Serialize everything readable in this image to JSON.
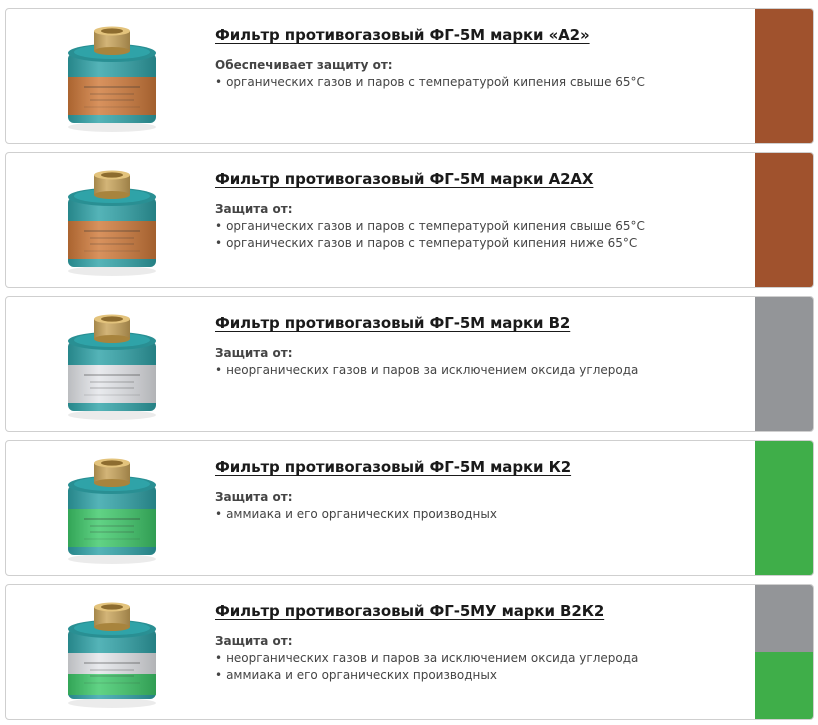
{
  "products": [
    {
      "title": "Фильтр противогазовый ФГ-5М марки «А2»",
      "subtitle": "Обеспечивает защиту от:",
      "items": [
        "органических газов и паров с температурой кипения свыше 65°С"
      ],
      "colors": [
        "#a0522d"
      ],
      "image": {
        "body": "#2fa3a8",
        "band": "#d07a3a",
        "label": "ФГ-5М  А2"
      }
    },
    {
      "title": "Фильтр противогазовый ФГ-5М марки А2АХ",
      "subtitle": "Защита от:",
      "items": [
        "органических газов и паров с температурой кипения свыше 65°С",
        "органических газов и паров с температурой кипения ниже 65°С"
      ],
      "colors": [
        "#a0522d"
      ],
      "image": {
        "body": "#2fa3a8",
        "band": "#d07a3a",
        "label": "ФГ-5М  А2АХ"
      }
    },
    {
      "title": "Фильтр противогазовый ФГ-5М марки В2",
      "subtitle": "Защита от:",
      "items": [
        "неорганических газов и паров за исключением оксида углерода"
      ],
      "colors": [
        "#939598"
      ],
      "image": {
        "body": "#2fa3a8",
        "band": "#e4e6ea",
        "label": "ФГ-5М  В2"
      }
    },
    {
      "title": "Фильтр противогазовый ФГ-5М марки К2",
      "subtitle": "Защита от:",
      "items": [
        "аммиака и его органических производных"
      ],
      "colors": [
        "#3fae49"
      ],
      "image": {
        "body": "#2fa3a8",
        "band": "#3ec96a",
        "label": "ФГ-5М  К2"
      }
    },
    {
      "title": "Фильтр противогазовый ФГ-5МУ марки В2К2",
      "subtitle": "Защита от:",
      "items": [
        "неорганических газов и паров за исключением оксида углерода",
        "аммиака и его органических производных"
      ],
      "colors": [
        "#939598",
        "#3fae49"
      ],
      "image": {
        "body": "#2fa3a8",
        "band": "#e4e6ea",
        "band2": "#3ec96a",
        "label": "ФГ-5МУ  В2К2"
      }
    }
  ]
}
